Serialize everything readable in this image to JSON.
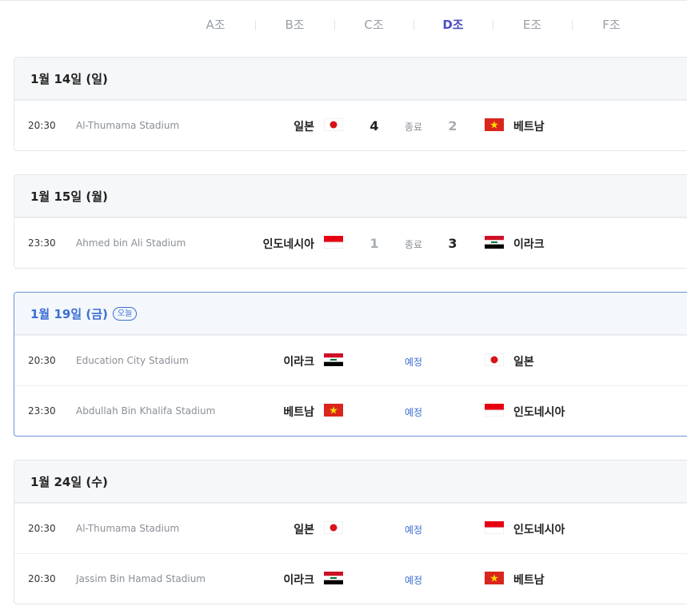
{
  "tabs": [
    {
      "label": "A조",
      "active": false
    },
    {
      "label": "B조",
      "active": false
    },
    {
      "label": "C조",
      "active": false
    },
    {
      "label": "D조",
      "active": true
    },
    {
      "label": "E조",
      "active": false
    },
    {
      "label": "F조",
      "active": false
    }
  ],
  "today_badge": "오늘",
  "days": [
    {
      "date": "1월 14일 (일)",
      "matches": [
        {
          "time": "20:30",
          "stadium": "Al-Thumama Stadium",
          "home": "일본",
          "home_flag": "japan",
          "home_score": "4",
          "status": "종료",
          "away_score": "2",
          "away": "베트남",
          "away_flag": "vietnam"
        }
      ]
    },
    {
      "date": "1월 15일 (월)",
      "matches": [
        {
          "time": "23:30",
          "stadium": "Ahmed bin Ali Stadium",
          "home": "인도네시아",
          "home_flag": "indonesia",
          "home_score": "1",
          "status": "종료",
          "away_score": "3",
          "away": "이라크",
          "away_flag": "iraq"
        }
      ]
    },
    {
      "date": "1월 19일 (금)",
      "matches": [
        {
          "time": "20:30",
          "stadium": "Education City Stadium",
          "home": "이라크",
          "home_flag": "iraq",
          "status": "예정",
          "away": "일본",
          "away_flag": "japan"
        },
        {
          "time": "23:30",
          "stadium": "Abdullah Bin Khalifa Stadium",
          "home": "베트남",
          "home_flag": "vietnam",
          "status": "예정",
          "away": "인도네시아",
          "away_flag": "indonesia"
        }
      ]
    },
    {
      "date": "1월 24일 (수)",
      "matches": [
        {
          "time": "20:30",
          "stadium": "Al-Thumama Stadium",
          "home": "일본",
          "home_flag": "japan",
          "status": "예정",
          "away": "인도네시아",
          "away_flag": "indonesia"
        },
        {
          "time": "20:30",
          "stadium": "Jassim Bin Hamad Stadium",
          "home": "이라크",
          "home_flag": "iraq",
          "status": "예정",
          "away": "베트남",
          "away_flag": "vietnam"
        }
      ]
    }
  ]
}
